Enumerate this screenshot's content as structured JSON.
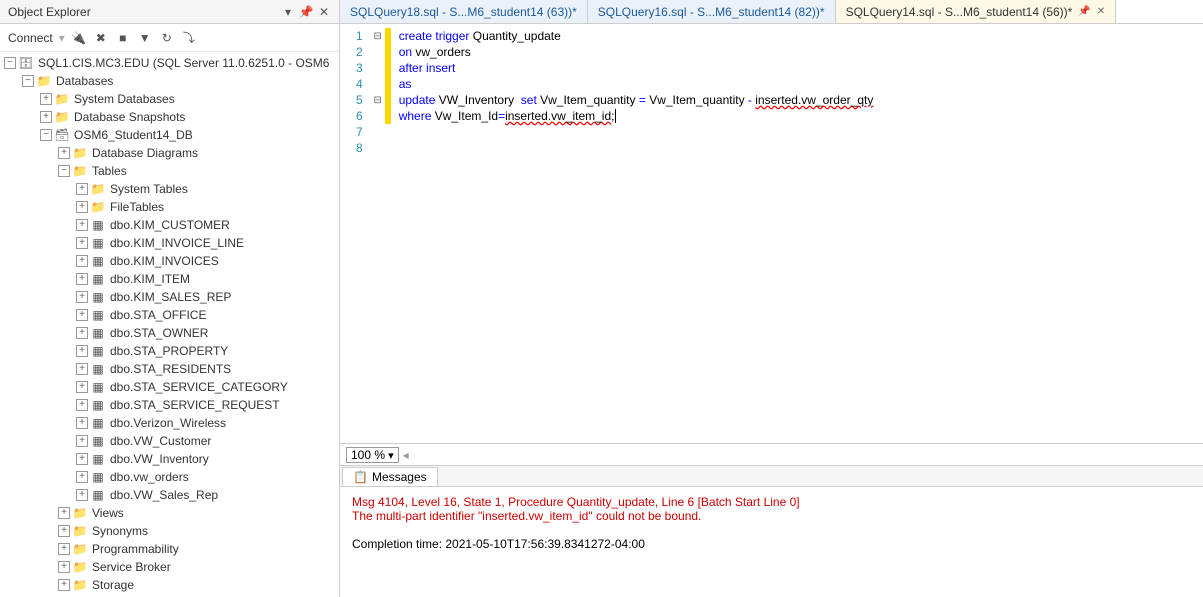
{
  "explorer": {
    "title": "Object Explorer",
    "connect_label": "Connect",
    "root": "SQL1.CIS.MC3.EDU (SQL Server 11.0.6251.0 - OSM6",
    "databases_label": "Databases",
    "sys_db": "System Databases",
    "db_snap": "Database Snapshots",
    "student_db": "OSM6_Student14_DB",
    "db_diagrams": "Database Diagrams",
    "tables_label": "Tables",
    "sys_tables": "System Tables",
    "file_tables": "FileTables",
    "tables": [
      "dbo.KIM_CUSTOMER",
      "dbo.KIM_INVOICE_LINE",
      "dbo.KIM_INVOICES",
      "dbo.KIM_ITEM",
      "dbo.KIM_SALES_REP",
      "dbo.STA_OFFICE",
      "dbo.STA_OWNER",
      "dbo.STA_PROPERTY",
      "dbo.STA_RESIDENTS",
      "dbo.STA_SERVICE_CATEGORY",
      "dbo.STA_SERVICE_REQUEST",
      "dbo.Verizon_Wireless",
      "dbo.VW_Customer",
      "dbo.VW_Inventory",
      "dbo.vw_orders",
      "dbo.VW_Sales_Rep"
    ],
    "views": "Views",
    "synonyms": "Synonyms",
    "programmability": "Programmability",
    "service_broker": "Service Broker",
    "storage": "Storage"
  },
  "tabs": [
    {
      "label": "SQLQuery18.sql - S...M6_student14 (63))*",
      "active": false
    },
    {
      "label": "SQLQuery16.sql - S...M6_student14 (82))*",
      "active": false
    },
    {
      "label": "SQLQuery14.sql - S...M6_student14 (56))*",
      "active": true
    }
  ],
  "editor": {
    "lines": [
      {
        "n": 1,
        "marker": "⊟",
        "t": [
          [
            "kw",
            "create"
          ],
          [
            "",
            ""
          ],
          [
            "kw",
            "trigger"
          ],
          [
            "",
            " Quantity_update"
          ]
        ]
      },
      {
        "n": 2,
        "marker": "",
        "t": [
          [
            "kw",
            "on"
          ],
          [
            "",
            " vw_orders"
          ]
        ]
      },
      {
        "n": 3,
        "marker": "",
        "t": [
          [
            "kw",
            "after"
          ],
          [
            "",
            ""
          ],
          [
            "kw",
            "insert"
          ]
        ]
      },
      {
        "n": 4,
        "marker": "",
        "t": [
          [
            "kw",
            "as"
          ]
        ]
      },
      {
        "n": 5,
        "marker": "⊟",
        "t": [
          [
            "kw",
            "update"
          ],
          [
            "",
            " VW_Inventory  "
          ],
          [
            "kw",
            "set"
          ],
          [
            "",
            " Vw_Item_quantity "
          ],
          [
            "kw",
            "="
          ],
          [
            "",
            " Vw_Item_quantity "
          ],
          [
            "kw",
            "-"
          ],
          [
            "",
            " "
          ],
          [
            "err",
            "inserted.vw_order_qty"
          ]
        ]
      },
      {
        "n": 6,
        "marker": "",
        "t": [
          [
            "kw",
            "where"
          ],
          [
            "",
            " Vw_Item_Id"
          ],
          [
            "kw",
            "="
          ],
          [
            "err",
            "inserted.vw_item_id"
          ],
          [
            "cursor",
            ";"
          ]
        ]
      },
      {
        "n": 7,
        "marker": "",
        "t": []
      },
      {
        "n": 8,
        "marker": "",
        "t": []
      }
    ]
  },
  "zoom": "100 %",
  "results": {
    "tab_label": "Messages",
    "error_line1": "Msg 4104, Level 16, State 1, Procedure Quantity_update, Line 6 [Batch Start Line 0]",
    "error_line2": "The multi-part identifier \"inserted.vw_item_id\" could not be bound.",
    "completion": "Completion time: 2021-05-10T17:56:39.8341272-04:00"
  }
}
